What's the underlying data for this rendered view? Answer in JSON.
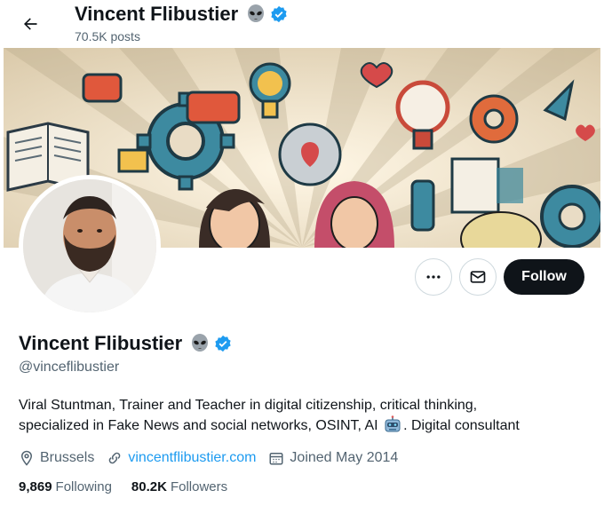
{
  "header": {
    "name": "Vincent Flibustier",
    "posts": "70.5K posts"
  },
  "profile": {
    "name": "Vincent Flibustier",
    "handle": "@vinceflibustier",
    "bio_line1": "Viral Stuntman, Trainer and Teacher in digital citizenship, critical thinking,",
    "bio_line2_before": "specialized in Fake News and social networks, OSINT, AI",
    "bio_line2_after": ". Digital consultant",
    "location": "Brussels",
    "website": "vincentflibustier.com",
    "joined": "Joined May 2014",
    "following_count": "9,869",
    "following_label": "Following",
    "followers_count": "80.2K",
    "followers_label": "Followers"
  },
  "actions": {
    "follow_label": "Follow"
  },
  "icons": {
    "back": "arrow-left-icon",
    "more": "more-dots-icon",
    "message": "envelope-icon",
    "location": "location-pin-icon",
    "link": "link-icon",
    "calendar": "calendar-icon",
    "verified": "verified-badge-icon",
    "alien": "alien-emoji-icon",
    "robot": "robot-emoji-icon"
  },
  "colors": {
    "accent": "#1d9bf0",
    "text": "#0f1419",
    "muted": "#536471",
    "follow_bg": "#0f1419"
  }
}
